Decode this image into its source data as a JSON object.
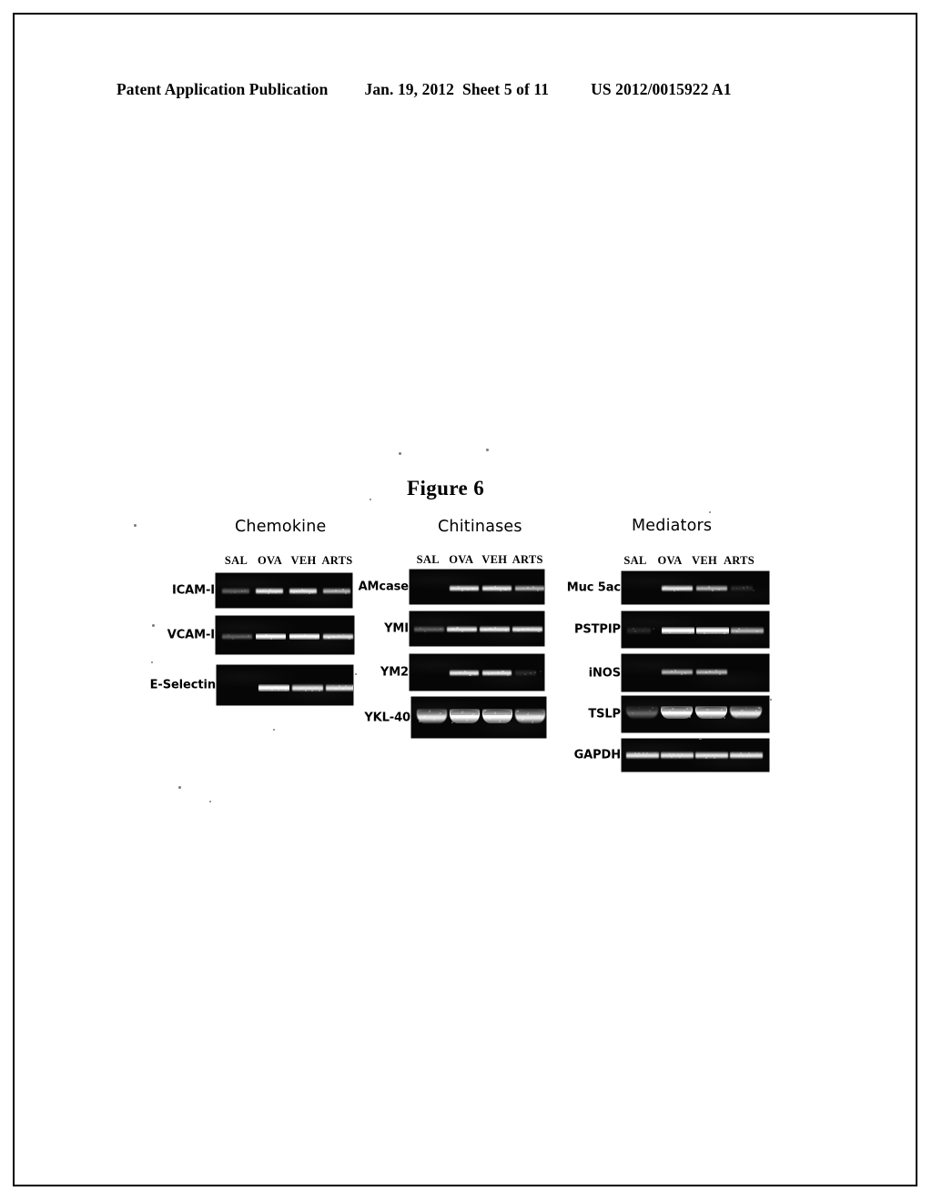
{
  "header": {
    "publication": "Patent Application Publication",
    "date": "Jan. 19, 2012",
    "sheet": "Sheet 5 of 11",
    "number": "US 2012/0015922 A1"
  },
  "figure": {
    "title": "Figure 6",
    "lane_labels": [
      "SAL",
      "OVA",
      "VEH",
      "ARTS"
    ],
    "panels": [
      {
        "id": "chemokine",
        "title": "Chemokine",
        "rows": [
          {
            "label": "ICAM-I",
            "bands": [
              {
                "lane": "SAL",
                "intensity": "faint"
              },
              {
                "lane": "OVA",
                "intensity": "strong"
              },
              {
                "lane": "VEH",
                "intensity": "strong"
              },
              {
                "lane": "ARTS",
                "intensity": "medium"
              }
            ]
          },
          {
            "label": "VCAM-I",
            "bands": [
              {
                "lane": "SAL",
                "intensity": "faint"
              },
              {
                "lane": "OVA",
                "intensity": "bright"
              },
              {
                "lane": "VEH",
                "intensity": "bright"
              },
              {
                "lane": "ARTS",
                "intensity": "strong"
              }
            ]
          },
          {
            "label": "E-Selectin",
            "bands": [
              {
                "lane": "SAL",
                "intensity": "none"
              },
              {
                "lane": "OVA",
                "intensity": "bright"
              },
              {
                "lane": "VEH",
                "intensity": "strong"
              },
              {
                "lane": "ARTS",
                "intensity": "strong"
              }
            ]
          }
        ]
      },
      {
        "id": "chitinases",
        "title": "Chitinases",
        "rows": [
          {
            "label": "AMcase",
            "bands": [
              {
                "lane": "SAL",
                "intensity": "none"
              },
              {
                "lane": "OVA",
                "intensity": "strong"
              },
              {
                "lane": "VEH",
                "intensity": "strong"
              },
              {
                "lane": "ARTS",
                "intensity": "medium"
              }
            ]
          },
          {
            "label": "YMI",
            "bands": [
              {
                "lane": "SAL",
                "intensity": "faint"
              },
              {
                "lane": "OVA",
                "intensity": "strong"
              },
              {
                "lane": "VEH",
                "intensity": "strong"
              },
              {
                "lane": "ARTS",
                "intensity": "strong"
              }
            ]
          },
          {
            "label": "YM2",
            "bands": [
              {
                "lane": "SAL",
                "intensity": "none"
              },
              {
                "lane": "OVA",
                "intensity": "strong"
              },
              {
                "lane": "VEH",
                "intensity": "strong"
              },
              {
                "lane": "ARTS",
                "intensity": "trace"
              }
            ]
          },
          {
            "label": "YKL-40",
            "bands": [
              {
                "lane": "SAL",
                "intensity": "strong"
              },
              {
                "lane": "OVA",
                "intensity": "bright"
              },
              {
                "lane": "VEH",
                "intensity": "bright"
              },
              {
                "lane": "ARTS",
                "intensity": "strong"
              }
            ]
          }
        ]
      },
      {
        "id": "mediators",
        "title": "Mediators",
        "rows": [
          {
            "label": "Muc 5ac",
            "bands": [
              {
                "lane": "SAL",
                "intensity": "none"
              },
              {
                "lane": "OVA",
                "intensity": "strong"
              },
              {
                "lane": "VEH",
                "intensity": "medium"
              },
              {
                "lane": "ARTS",
                "intensity": "trace"
              }
            ]
          },
          {
            "label": "PSTPIP",
            "bands": [
              {
                "lane": "SAL",
                "intensity": "trace"
              },
              {
                "lane": "OVA",
                "intensity": "bright"
              },
              {
                "lane": "VEH",
                "intensity": "bright"
              },
              {
                "lane": "ARTS",
                "intensity": "medium"
              }
            ]
          },
          {
            "label": "iNOS",
            "bands": [
              {
                "lane": "SAL",
                "intensity": "none"
              },
              {
                "lane": "OVA",
                "intensity": "medium"
              },
              {
                "lane": "VEH",
                "intensity": "medium"
              },
              {
                "lane": "ARTS",
                "intensity": "none"
              }
            ]
          },
          {
            "label": "TSLP",
            "bands": [
              {
                "lane": "SAL",
                "intensity": "faint"
              },
              {
                "lane": "OVA",
                "intensity": "bright"
              },
              {
                "lane": "VEH",
                "intensity": "bright"
              },
              {
                "lane": "ARTS",
                "intensity": "strong"
              }
            ]
          },
          {
            "label": "GAPDH",
            "bands": [
              {
                "lane": "SAL",
                "intensity": "strong"
              },
              {
                "lane": "OVA",
                "intensity": "strong"
              },
              {
                "lane": "VEH",
                "intensity": "strong"
              },
              {
                "lane": "ARTS",
                "intensity": "strong"
              }
            ]
          }
        ]
      }
    ]
  }
}
